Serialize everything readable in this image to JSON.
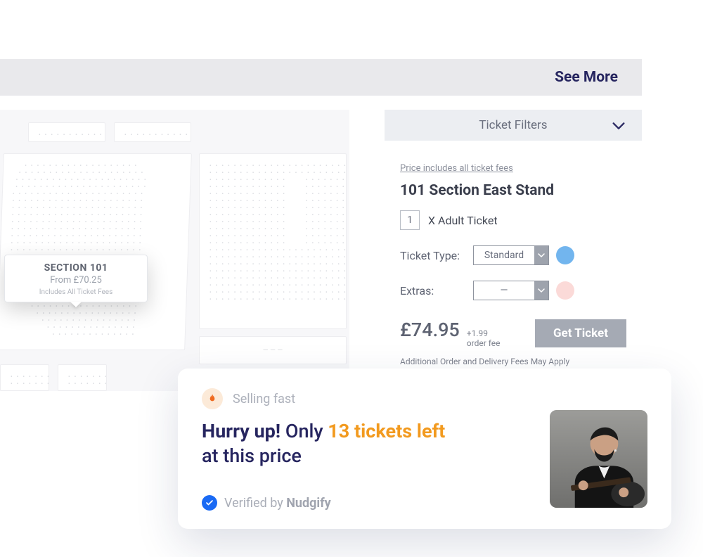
{
  "topbar": {
    "see_more": "See More"
  },
  "seatmap": {
    "popover": {
      "title": "SECTION 101",
      "from": "From £70.25",
      "includes": "Includes All Ticket Fees"
    }
  },
  "sidebar": {
    "filters_label": "Ticket Filters",
    "fees_note": "Price includes all ticket fees",
    "section_title": "101 Section East Stand",
    "qty": "1",
    "adult_label": "X Adult Ticket",
    "ticket_type_label": "Ticket Type:",
    "ticket_type_value": "Standard",
    "extras_label": "Extras:",
    "extras_value": "—",
    "price": "£74.95",
    "order_fee_amount": "+1.99",
    "order_fee_label": "order fee",
    "get_ticket": "Get Ticket",
    "additional": "Additional Order and Delivery Fees May Apply",
    "colors": {
      "type_dot": "#72b5ee",
      "extras_dot": "#fbdad8"
    }
  },
  "notif": {
    "tag": "Selling fast",
    "hurry": "Hurry up!",
    "only": " Only ",
    "tickets_left": "13 tickets left",
    "tail": "at this price",
    "verified_prefix": "Verified by ",
    "verified_brand": "Nudgify"
  }
}
